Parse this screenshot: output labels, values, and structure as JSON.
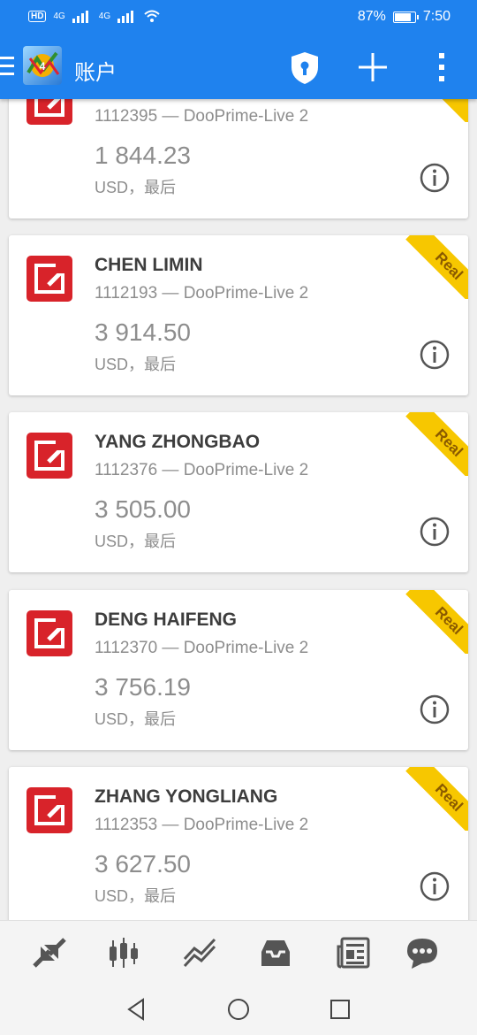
{
  "status_bar": {
    "network_1": "4G",
    "network_2": "4G",
    "battery": "87%",
    "time": "7:50"
  },
  "header": {
    "title": "账户",
    "menu_icon": "hamburger-icon",
    "logo": "metatrader-logo",
    "actions": [
      "shield-lock-icon",
      "plus-icon",
      "more-vert-icon"
    ]
  },
  "accounts": [
    {
      "name": "",
      "login": "1112395 — DooPrime-Live 2",
      "balance": "1 844.23",
      "currency": "USD，最后",
      "badge": ""
    },
    {
      "name": "CHEN LIMIN",
      "login": "1112193 — DooPrime-Live 2",
      "balance": "3 914.50",
      "currency": "USD，最后",
      "badge": "Real"
    },
    {
      "name": "YANG ZHONGBAO",
      "login": "1112376 — DooPrime-Live 2",
      "balance": "3 505.00",
      "currency": "USD，最后",
      "badge": "Real"
    },
    {
      "name": "DENG HAIFENG",
      "login": "1112370 — DooPrime-Live 2",
      "balance": "3 756.19",
      "currency": "USD，最后",
      "badge": "Real"
    },
    {
      "name": "ZHANG YONGLIANG",
      "login": "1112353 — DooPrime-Live 2",
      "balance": "3 627.50",
      "currency": "USD，最后",
      "badge": "Real"
    }
  ],
  "bottom_tabs": [
    "quotes-icon",
    "chart-icon",
    "trade-icon",
    "history-icon",
    "news-icon",
    "chat-icon"
  ],
  "system_nav": [
    "back-icon",
    "home-icon",
    "recents-icon"
  ],
  "colors": {
    "app_bar": "#1f82ee",
    "badge": "#f7c700",
    "logo_red": "#d8232a"
  }
}
